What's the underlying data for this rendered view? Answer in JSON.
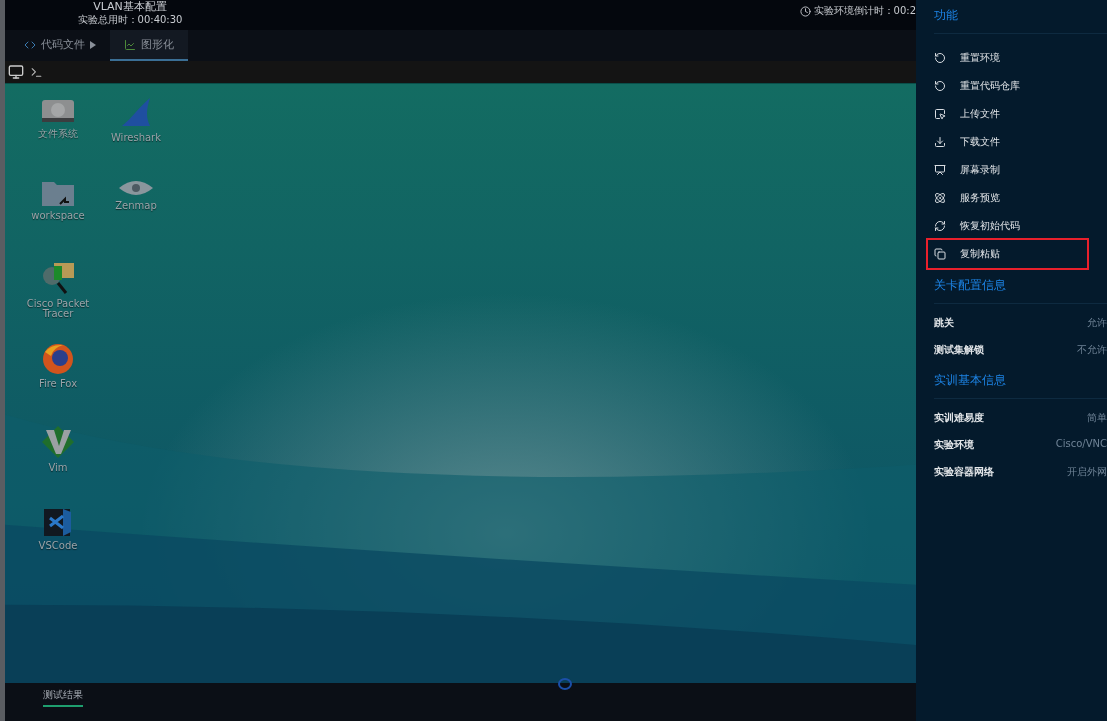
{
  "header": {
    "title": "VLAN基本配置",
    "elapsed": "实验总用时：00:40:30",
    "countdown": "实验环境倒计时：00:2"
  },
  "tabs": [
    {
      "label": "代码文件",
      "selected": false,
      "kind": "dropdown"
    },
    {
      "label": "图形化",
      "selected": true,
      "kind": "plain"
    }
  ],
  "desktop_rows": [
    [
      {
        "label": "文件系统"
      },
      {
        "label": "Wireshark"
      }
    ],
    [
      {
        "label": "workspace"
      },
      {
        "label": "Zenmap"
      }
    ],
    [
      {
        "label": "Cisco Packet Tracer"
      }
    ],
    [
      {
        "label": "Fire Fox"
      }
    ],
    [
      {
        "label": "Vim"
      }
    ],
    [
      {
        "label": "VSCode"
      }
    ]
  ],
  "bottom_tabs": [
    {
      "label": "测试结果",
      "selected": true
    }
  ],
  "panel": [
    {
      "title": "功能",
      "kind": "actions",
      "items": [
        {
          "label": "重置环境",
          "highlighted": false
        },
        {
          "label": "重置代码仓库",
          "highlighted": false
        },
        {
          "label": "上传文件",
          "highlighted": false
        },
        {
          "label": "下载文件",
          "highlighted": false
        },
        {
          "label": "屏幕录制",
          "highlighted": false
        },
        {
          "label": "服务预览",
          "highlighted": false
        },
        {
          "label": "恢复初始代码",
          "highlighted": false
        },
        {
          "label": "复制粘贴",
          "highlighted": true
        }
      ]
    },
    {
      "title": "关卡配置信息",
      "kind": "fields",
      "rows": [
        {
          "label": "跳关",
          "value": "允许"
        },
        {
          "label": "测试集解锁",
          "value": "不允许"
        }
      ]
    },
    {
      "title": "实训基本信息",
      "kind": "fields",
      "rows": [
        {
          "label": "实训难易度",
          "value": "简单"
        },
        {
          "label": "实验环境",
          "value": "Cisco/VNC"
        },
        {
          "label": "实验容器网络",
          "value": "开启外网"
        }
      ]
    }
  ]
}
